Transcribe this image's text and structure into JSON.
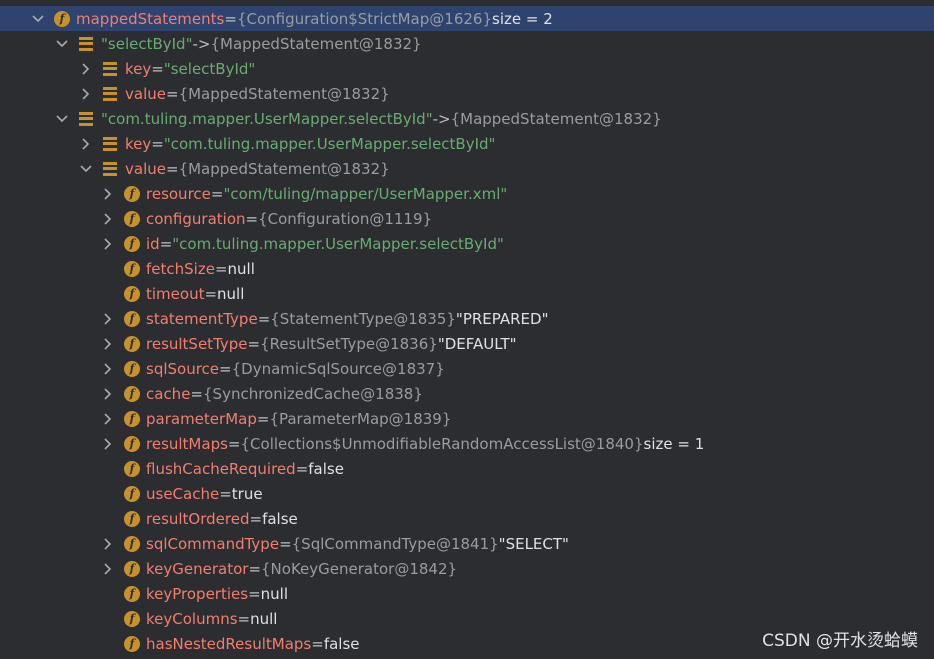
{
  "watermark": "CSDN @开水烫蛤蟆",
  "rows": [
    {
      "indent": 32,
      "arrow": "down",
      "icon": "f",
      "name": "mappedStatements",
      "eq": " = ",
      "ref": "{Configuration$StrictMap@1626}",
      "extra": "  size = 2",
      "selected": true
    },
    {
      "indent": 56,
      "arrow": "down",
      "icon": "map",
      "str": "\"selectById\"",
      "arrow2": " -> ",
      "ref": "{MappedStatement@1832}"
    },
    {
      "indent": 80,
      "arrow": "right",
      "icon": "map",
      "name": "key",
      "eq": " = ",
      "str": "\"selectById\""
    },
    {
      "indent": 80,
      "arrow": "right",
      "icon": "map",
      "name": "value",
      "eq": " = ",
      "ref": "{MappedStatement@1832}"
    },
    {
      "indent": 56,
      "arrow": "down",
      "icon": "map",
      "str": "\"com.tuling.mapper.UserMapper.selectById\"",
      "arrow2": " -> ",
      "ref": "{MappedStatement@1832}"
    },
    {
      "indent": 80,
      "arrow": "right",
      "icon": "map",
      "name": "key",
      "eq": " = ",
      "str": "\"com.tuling.mapper.UserMapper.selectById\""
    },
    {
      "indent": 80,
      "arrow": "down",
      "icon": "map",
      "name": "value",
      "eq": " = ",
      "ref": "{MappedStatement@1832}"
    },
    {
      "indent": 102,
      "arrow": "right",
      "icon": "f",
      "name": "resource",
      "eq": " = ",
      "str": "\"com/tuling/mapper/UserMapper.xml\""
    },
    {
      "indent": 102,
      "arrow": "right",
      "icon": "f",
      "name": "configuration",
      "eq": " = ",
      "ref": "{Configuration@1119}"
    },
    {
      "indent": 102,
      "arrow": "right",
      "icon": "f",
      "name": "id",
      "eq": " = ",
      "str": "\"com.tuling.mapper.UserMapper.selectById\""
    },
    {
      "indent": 102,
      "arrow": "none",
      "icon": "f",
      "name": "fetchSize",
      "eq": " = ",
      "plain": "null"
    },
    {
      "indent": 102,
      "arrow": "none",
      "icon": "f",
      "name": "timeout",
      "eq": " = ",
      "plain": "null"
    },
    {
      "indent": 102,
      "arrow": "right",
      "icon": "f",
      "name": "statementType",
      "eq": " = ",
      "ref": "{StatementType@1835}",
      "plain": " \"PREPARED\""
    },
    {
      "indent": 102,
      "arrow": "right",
      "icon": "f",
      "name": "resultSetType",
      "eq": " = ",
      "ref": "{ResultSetType@1836}",
      "plain": " \"DEFAULT\""
    },
    {
      "indent": 102,
      "arrow": "right",
      "icon": "f",
      "name": "sqlSource",
      "eq": " = ",
      "ref": "{DynamicSqlSource@1837}"
    },
    {
      "indent": 102,
      "arrow": "right",
      "icon": "f",
      "name": "cache",
      "eq": " = ",
      "ref": "{SynchronizedCache@1838}"
    },
    {
      "indent": 102,
      "arrow": "right",
      "icon": "f",
      "name": "parameterMap",
      "eq": " = ",
      "ref": "{ParameterMap@1839}"
    },
    {
      "indent": 102,
      "arrow": "right",
      "icon": "f",
      "name": "resultMaps",
      "eq": " = ",
      "ref": "{Collections$UnmodifiableRandomAccessList@1840}",
      "extra": "  size = 1"
    },
    {
      "indent": 102,
      "arrow": "none",
      "icon": "f",
      "name": "flushCacheRequired",
      "eq": " = ",
      "plain": "false"
    },
    {
      "indent": 102,
      "arrow": "none",
      "icon": "f",
      "name": "useCache",
      "eq": " = ",
      "plain": "true"
    },
    {
      "indent": 102,
      "arrow": "none",
      "icon": "f",
      "name": "resultOrdered",
      "eq": " = ",
      "plain": "false"
    },
    {
      "indent": 102,
      "arrow": "right",
      "icon": "f",
      "name": "sqlCommandType",
      "eq": " = ",
      "ref": "{SqlCommandType@1841}",
      "plain": " \"SELECT\""
    },
    {
      "indent": 102,
      "arrow": "right",
      "icon": "f",
      "name": "keyGenerator",
      "eq": " = ",
      "ref": "{NoKeyGenerator@1842}"
    },
    {
      "indent": 102,
      "arrow": "none",
      "icon": "f",
      "name": "keyProperties",
      "eq": " = ",
      "plain": "null"
    },
    {
      "indent": 102,
      "arrow": "none",
      "icon": "f",
      "name": "keyColumns",
      "eq": " = ",
      "plain": "null"
    },
    {
      "indent": 102,
      "arrow": "none",
      "icon": "f",
      "name": "hasNestedResultMaps",
      "eq": " = ",
      "plain": "false"
    }
  ]
}
